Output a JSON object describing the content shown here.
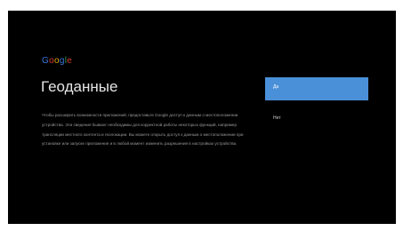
{
  "brand": {
    "logo_letters": [
      {
        "char": "G",
        "color": "#4285F4"
      },
      {
        "char": "o",
        "color": "#EA4335"
      },
      {
        "char": "o",
        "color": "#FBBC05"
      },
      {
        "char": "g",
        "color": "#4285F4"
      },
      {
        "char": "l",
        "color": "#34A853"
      },
      {
        "char": "e",
        "color": "#EA4335"
      }
    ]
  },
  "screen": {
    "title": "Геоданные",
    "description": "Чтобы расширить возможности приложений, предоставьте Google доступ к данным о местоположении устройства. Эти сведения бывают необходимы для корректной работы некоторых функций, например трансляции местного контента и геолокации. Вы можете открыть доступ к данным о местоположении при установке или запуске приложения и в любой момент изменить разрешения в настройках устройства."
  },
  "options": [
    {
      "label": "Да",
      "selected": true
    },
    {
      "label": "Нет",
      "selected": false
    }
  ],
  "colors": {
    "background": "#000000",
    "accent": "#4a90d9",
    "title_text": "#e6e6e6",
    "body_text": "#9a9a9a"
  }
}
